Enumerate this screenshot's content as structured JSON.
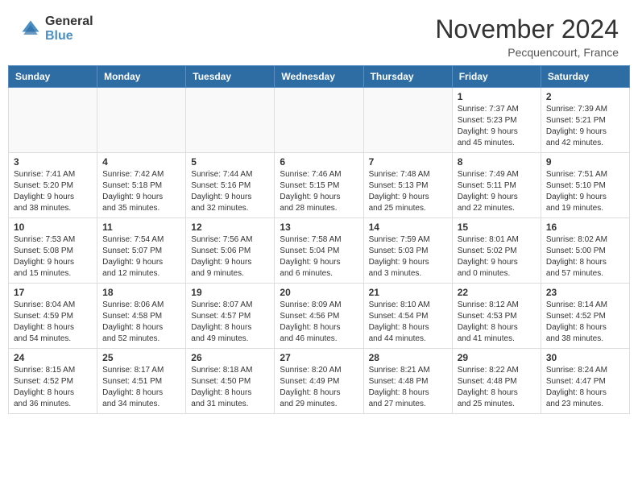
{
  "header": {
    "logo_general": "General",
    "logo_blue": "Blue",
    "month_title": "November 2024",
    "location": "Pecquencourt, France"
  },
  "days_of_week": [
    "Sunday",
    "Monday",
    "Tuesday",
    "Wednesday",
    "Thursday",
    "Friday",
    "Saturday"
  ],
  "weeks": [
    {
      "days": [
        {
          "num": "",
          "info": ""
        },
        {
          "num": "",
          "info": ""
        },
        {
          "num": "",
          "info": ""
        },
        {
          "num": "",
          "info": ""
        },
        {
          "num": "",
          "info": ""
        },
        {
          "num": "1",
          "info": "Sunrise: 7:37 AM\nSunset: 5:23 PM\nDaylight: 9 hours\nand 45 minutes."
        },
        {
          "num": "2",
          "info": "Sunrise: 7:39 AM\nSunset: 5:21 PM\nDaylight: 9 hours\nand 42 minutes."
        }
      ]
    },
    {
      "days": [
        {
          "num": "3",
          "info": "Sunrise: 7:41 AM\nSunset: 5:20 PM\nDaylight: 9 hours\nand 38 minutes."
        },
        {
          "num": "4",
          "info": "Sunrise: 7:42 AM\nSunset: 5:18 PM\nDaylight: 9 hours\nand 35 minutes."
        },
        {
          "num": "5",
          "info": "Sunrise: 7:44 AM\nSunset: 5:16 PM\nDaylight: 9 hours\nand 32 minutes."
        },
        {
          "num": "6",
          "info": "Sunrise: 7:46 AM\nSunset: 5:15 PM\nDaylight: 9 hours\nand 28 minutes."
        },
        {
          "num": "7",
          "info": "Sunrise: 7:48 AM\nSunset: 5:13 PM\nDaylight: 9 hours\nand 25 minutes."
        },
        {
          "num": "8",
          "info": "Sunrise: 7:49 AM\nSunset: 5:11 PM\nDaylight: 9 hours\nand 22 minutes."
        },
        {
          "num": "9",
          "info": "Sunrise: 7:51 AM\nSunset: 5:10 PM\nDaylight: 9 hours\nand 19 minutes."
        }
      ]
    },
    {
      "days": [
        {
          "num": "10",
          "info": "Sunrise: 7:53 AM\nSunset: 5:08 PM\nDaylight: 9 hours\nand 15 minutes."
        },
        {
          "num": "11",
          "info": "Sunrise: 7:54 AM\nSunset: 5:07 PM\nDaylight: 9 hours\nand 12 minutes."
        },
        {
          "num": "12",
          "info": "Sunrise: 7:56 AM\nSunset: 5:06 PM\nDaylight: 9 hours\nand 9 minutes."
        },
        {
          "num": "13",
          "info": "Sunrise: 7:58 AM\nSunset: 5:04 PM\nDaylight: 9 hours\nand 6 minutes."
        },
        {
          "num": "14",
          "info": "Sunrise: 7:59 AM\nSunset: 5:03 PM\nDaylight: 9 hours\nand 3 minutes."
        },
        {
          "num": "15",
          "info": "Sunrise: 8:01 AM\nSunset: 5:02 PM\nDaylight: 9 hours\nand 0 minutes."
        },
        {
          "num": "16",
          "info": "Sunrise: 8:02 AM\nSunset: 5:00 PM\nDaylight: 8 hours\nand 57 minutes."
        }
      ]
    },
    {
      "days": [
        {
          "num": "17",
          "info": "Sunrise: 8:04 AM\nSunset: 4:59 PM\nDaylight: 8 hours\nand 54 minutes."
        },
        {
          "num": "18",
          "info": "Sunrise: 8:06 AM\nSunset: 4:58 PM\nDaylight: 8 hours\nand 52 minutes."
        },
        {
          "num": "19",
          "info": "Sunrise: 8:07 AM\nSunset: 4:57 PM\nDaylight: 8 hours\nand 49 minutes."
        },
        {
          "num": "20",
          "info": "Sunrise: 8:09 AM\nSunset: 4:56 PM\nDaylight: 8 hours\nand 46 minutes."
        },
        {
          "num": "21",
          "info": "Sunrise: 8:10 AM\nSunset: 4:54 PM\nDaylight: 8 hours\nand 44 minutes."
        },
        {
          "num": "22",
          "info": "Sunrise: 8:12 AM\nSunset: 4:53 PM\nDaylight: 8 hours\nand 41 minutes."
        },
        {
          "num": "23",
          "info": "Sunrise: 8:14 AM\nSunset: 4:52 PM\nDaylight: 8 hours\nand 38 minutes."
        }
      ]
    },
    {
      "days": [
        {
          "num": "24",
          "info": "Sunrise: 8:15 AM\nSunset: 4:52 PM\nDaylight: 8 hours\nand 36 minutes."
        },
        {
          "num": "25",
          "info": "Sunrise: 8:17 AM\nSunset: 4:51 PM\nDaylight: 8 hours\nand 34 minutes."
        },
        {
          "num": "26",
          "info": "Sunrise: 8:18 AM\nSunset: 4:50 PM\nDaylight: 8 hours\nand 31 minutes."
        },
        {
          "num": "27",
          "info": "Sunrise: 8:20 AM\nSunset: 4:49 PM\nDaylight: 8 hours\nand 29 minutes."
        },
        {
          "num": "28",
          "info": "Sunrise: 8:21 AM\nSunset: 4:48 PM\nDaylight: 8 hours\nand 27 minutes."
        },
        {
          "num": "29",
          "info": "Sunrise: 8:22 AM\nSunset: 4:48 PM\nDaylight: 8 hours\nand 25 minutes."
        },
        {
          "num": "30",
          "info": "Sunrise: 8:24 AM\nSunset: 4:47 PM\nDaylight: 8 hours\nand 23 minutes."
        }
      ]
    }
  ]
}
